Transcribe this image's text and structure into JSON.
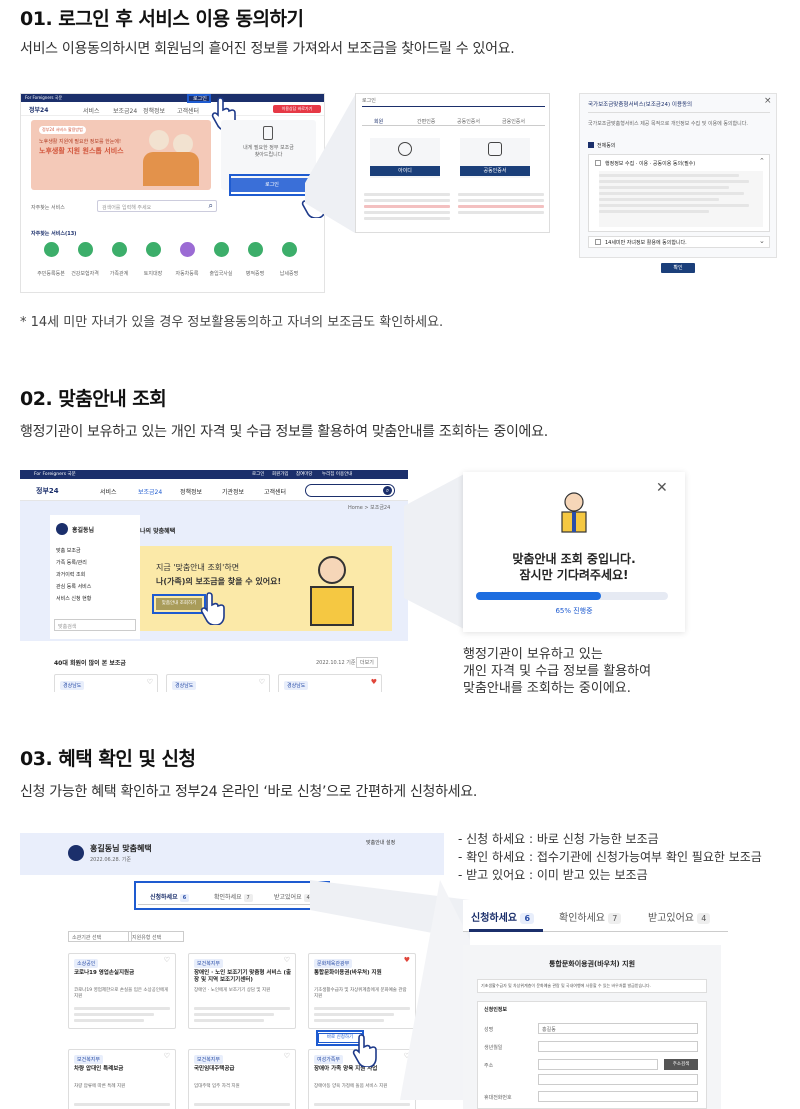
{
  "section1": {
    "title": "01. 로그인 후 서비스 이용 동의하기",
    "desc": "서비스 이용동의하시면 회원님의 흩어진 정보를 가져와서 보조금을 찾아드릴 수 있어요.",
    "note": "* 14세 미만 자녀가 있을 경우 정보활용동의하고 자녀의 보조금도 확인하세요.",
    "mock_home": {
      "top_left": "For Foreigners  국문",
      "logo": "정부24",
      "nav": [
        "서비스",
        "보조금24",
        "정책정보",
        "고객센터"
      ],
      "login": "로그인",
      "cta": "이용상담 바로가기",
      "banner_tag": "정부24 서비스 활용방법",
      "banner_line1": "노후생활 지원에 필요한 정보를 한눈에!",
      "banner_title": "노후생활 지원 원스톱 서비스",
      "right_text1": "내게 필요한 정부 보조금",
      "right_text2": "찾아드립니다",
      "right_btn": "로그인",
      "search_label": "자주찾는 서비스",
      "search_placeholder": "검색어를 입력해 주세요",
      "cat_title": "자주찾는 서비스(13)",
      "cats": [
        "주민등록등본",
        "건강보험자격",
        "가족관계",
        "토지대장",
        "자동차등록",
        "출입국사실",
        "병적증명",
        "납세증명"
      ]
    },
    "mock_login": {
      "title": "로그인",
      "tabs": [
        "회원",
        "간편인증",
        "공동인증서",
        "금융인증서"
      ],
      "btn1": "아이디",
      "btn2": "공동인증서"
    },
    "mock_consent": {
      "title": "국가보조금맞춤형서비스(보조금24) 이용동의",
      "intro": "국가보조금맞춤형서비스 제공 목적으로 개인정보 수집 및 이용에 동의합니다.",
      "all_agree": "전체동의",
      "item1": "행정정보 수집 · 이용 · 공동이용 동의(필수)",
      "item2": "14세미만 자녀정보 활용에 동의합니다.",
      "confirm": "확인"
    }
  },
  "section2": {
    "title": "02. 맞춤안내 조회",
    "desc": "행정기관이 보유하고 있는  개인 자격 및 수급 정보를 활용하여 맞춤안내를 조회하는 중이에요.",
    "mock": {
      "top_left": "For Foreigners  국문",
      "top_right": [
        "로그인",
        "회원가입",
        "참여마당",
        "누리집 이용안내"
      ],
      "logo": "정부24",
      "nav": [
        "서비스",
        "보조금24",
        "정책정보",
        "기관정보",
        "고객센터"
      ],
      "breadcrumb": "Home > 보조금24",
      "user": "홍길동님",
      "menu_title": "나의 맞춤혜택",
      "menu": [
        "맞춤 보조금",
        "가족 등록/관리",
        "과거이력 조회",
        "관심 등록 서비스",
        "서비스 신청 현황"
      ],
      "search_placeholder": "맞춤검색",
      "promo_line1": "지금 '맞춤안내 조회'하면",
      "promo_line2": "나(가족)의 보조금을 찾을 수 있어요!",
      "promo_btn": "맞춤안내 조회하기",
      "list_title": "40대 회원이 많이 본 보조금",
      "list_date": "2022.10.12 기준",
      "list_more": "더보기",
      "card_tag": "경상남도"
    },
    "loading": {
      "line1": "맞춤안내 조회 중입니다.",
      "line2": "잠시만 기다려주세요!",
      "progress_label": "65% 진행중",
      "progress": 0.65
    },
    "side_text": [
      "행정기관이 보유하고 있는",
      "개인 자격 및 수급 정보를 활용하여",
      "맞춤안내를 조회하는 중이에요."
    ]
  },
  "section3": {
    "title": "03. 혜택 확인 및 신청",
    "desc": "신청 가능한 혜택 확인하고 정부24 온라인 ‘바로 신청’으로 간편하게 신청하세요.",
    "legend": [
      "- 신청 하세요 : 바로 신청 가능한 보조금",
      "- 확인 하세요 : 접수기관에 신청가능여부 확인 필요한 보조금",
      "- 받고 있어요 : 이미 받고 있는 보조금"
    ],
    "mock": {
      "user": "홍길동님 맞춤혜택",
      "date": "2022.06.28. 기준",
      "right_link": "맞춤안내 설정",
      "tabs": [
        {
          "label": "신청하세요",
          "count": "6"
        },
        {
          "label": "확인하세요",
          "count": "7"
        },
        {
          "label": "받고있어요",
          "count": "4"
        }
      ],
      "filter1": "소관기관 선택",
      "filter2": "지원유형 선택",
      "cards": [
        {
          "tag": "소상공인",
          "title": "코로나19 영업손실지원금",
          "desc": "코로나19 영업제한으로 손실을 입은 소상공인에게 지원"
        },
        {
          "tag": "보건복지부",
          "title": "장애인 · 노인 보조기기 맞춤형 서비스 (출장 및 지역 보조기기센터)",
          "desc": "장애인 · 노인에게 보조기기 상담 및 지원"
        },
        {
          "tag": "문화체육관광부",
          "title": "통합문화이용권(바우처) 지원",
          "desc": "기초생활수급자 및 차상위계층에게 문화예술 관람 지원"
        },
        {
          "tag": "보건복지부",
          "title": "차량 압대인 특례보금",
          "desc": "차량 압류에 따른 특례 지원"
        },
        {
          "tag": "보건복지부",
          "title": "국민임대주택공급",
          "desc": "임대주택 입주 자격 지원"
        },
        {
          "tag": "여성가족부",
          "title": "장애아 가족 양육 지원 사업",
          "desc": "장애아동 양육 가정에 돌봄 서비스 지원"
        }
      ],
      "apply_btn": "바로 신청하기"
    },
    "zoom_tabs": [
      {
        "label": "신청하세요",
        "count": "6"
      },
      {
        "label": "확인하세요",
        "count": "7"
      },
      {
        "label": "받고있어요",
        "count": "4"
      }
    ],
    "form": {
      "title": "통합문화이용권(바우처) 지원",
      "notice": "기초생활수급자 및 차상위계층이 문화예술 관람 및 국내여행에 사용할 수 있는 바우처를 발급받습니다.",
      "section": "신청인정보",
      "labels": [
        "성명",
        "생년월일",
        "주소",
        "휴대전화번호"
      ],
      "name_value": "홍길동",
      "btn": "주소검색"
    }
  },
  "colors": {
    "accent": "#1e5bd0",
    "navy": "#1b2f6b",
    "banner": "#f4c9b8",
    "promo": "#fbe9a8"
  }
}
